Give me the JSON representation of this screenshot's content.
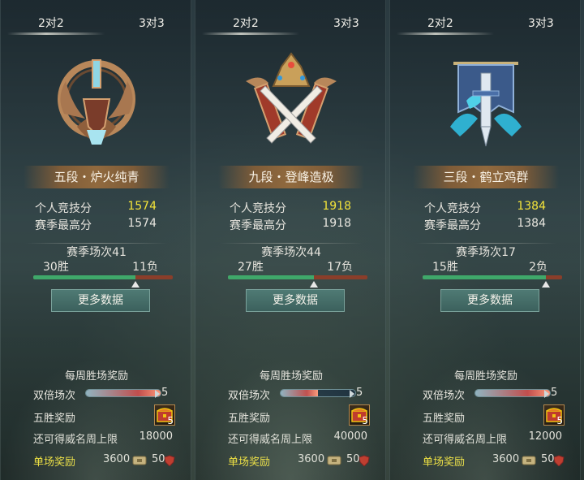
{
  "colors": {
    "highlight_gold": "#f4e43a",
    "win_green": "#3fa86a",
    "loss_red": "#8a3e2a",
    "button_teal": "#4f7a74"
  },
  "panels": [
    {
      "tab_2v2": "2对2",
      "tab_3v3": "3对3",
      "emblem_icon": "bronze-blade-rank-emblem-icon",
      "rank_name": "五段・炉火纯青",
      "score_label": "个人竞技分",
      "score_value": "1574",
      "best_label": "赛季最高分",
      "best_value": "1574",
      "season_matches": "赛季场次41",
      "wins": "30胜",
      "losses": "11负",
      "win_ratio": 0.732,
      "more_button": "更多数据",
      "weekly_title": "每周胜场奖励",
      "double_label": "双倍场次",
      "double_count": "5",
      "double_progress": 1.0,
      "five_win_label": "五胜奖励",
      "five_win_count": "5",
      "cap_label": "还可得威名周上限",
      "cap_value": "18000",
      "single_label": "单场奖励",
      "single_coin": "3600",
      "single_token": "50"
    },
    {
      "tab_2v2": "2对2",
      "tab_3v3": "3对3",
      "emblem_icon": "crowned-crossed-swords-emblem-icon",
      "rank_name": "九段・登峰造极",
      "score_label": "个人竞技分",
      "score_value": "1918",
      "best_label": "赛季最高分",
      "best_value": "1918",
      "season_matches": "赛季场次44",
      "wins": "27胜",
      "losses": "17负",
      "win_ratio": 0.614,
      "more_button": "更多数据",
      "weekly_title": "每周胜场奖励",
      "double_label": "双倍场次",
      "double_count": "5",
      "double_progress": 0.5,
      "five_win_label": "五胜奖励",
      "five_win_count": "5",
      "cap_label": "还可得威名周上限",
      "cap_value": "40000",
      "single_label": "单场奖励",
      "single_coin": "3600",
      "single_token": "50"
    },
    {
      "tab_2v2": "2对2",
      "tab_3v3": "3对3",
      "emblem_icon": "crane-banner-sword-emblem-icon",
      "rank_name": "三段・鹤立鸡群",
      "score_label": "个人竞技分",
      "score_value": "1384",
      "best_label": "赛季最高分",
      "best_value": "1384",
      "season_matches": "赛季场次17",
      "wins": "15胜",
      "losses": "2负",
      "win_ratio": 0.882,
      "more_button": "更多数据",
      "weekly_title": "每周胜场奖励",
      "double_label": "双倍场次",
      "double_count": "5",
      "double_progress": 1.0,
      "five_win_label": "五胜奖励",
      "five_win_count": "5",
      "cap_label": "还可得威名周上限",
      "cap_value": "12000",
      "single_label": "单场奖励",
      "single_coin": "3600",
      "single_token": "50"
    }
  ]
}
